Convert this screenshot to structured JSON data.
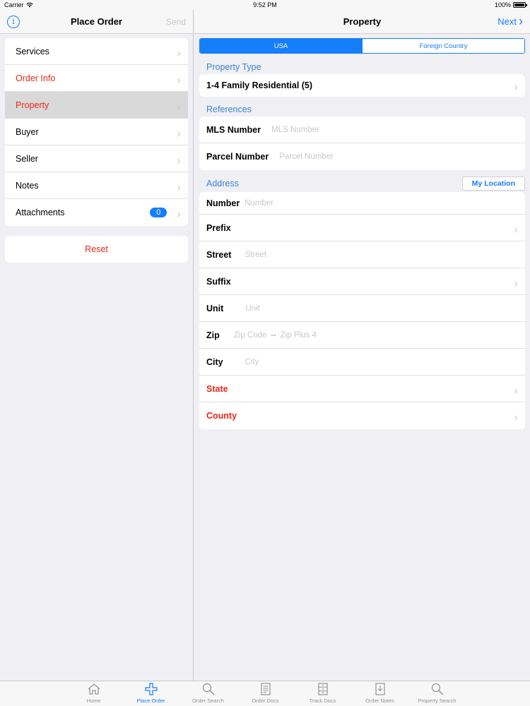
{
  "status": {
    "carrier": "Carrier",
    "time": "9:52 PM",
    "battery": "100%"
  },
  "left": {
    "title": "Place Order",
    "send": "Send",
    "menu": [
      {
        "label": "Services"
      },
      {
        "label": "Order Info"
      },
      {
        "label": "Property"
      },
      {
        "label": "Buyer"
      },
      {
        "label": "Seller"
      },
      {
        "label": "Notes"
      },
      {
        "label": "Attachments",
        "badge": "0"
      }
    ],
    "reset": "Reset"
  },
  "right": {
    "title": "Property",
    "next": "Next",
    "segments": [
      "USA",
      "Foreign Country"
    ],
    "property_type_header": "Property Type",
    "property_type_value": "1-4 Family Residential (5)",
    "references_header": "References",
    "mls_label": "MLS Number",
    "mls_placeholder": "MLS Number",
    "parcel_label": "Parcel Number",
    "parcel_placeholder": "Parcel Number",
    "address_header": "Address",
    "my_location": "My Location",
    "number_label": "Number",
    "number_placeholder": "Number",
    "prefix_label": "Prefix",
    "street_label": "Street",
    "street_placeholder": "Street",
    "suffix_label": "Suffix",
    "unit_label": "Unit",
    "unit_placeholder": "Unit",
    "zip_label": "Zip",
    "zip_placeholder": "Zip Code",
    "zip_dash": "--",
    "zip4_placeholder": "Zip Plus 4",
    "city_label": "City",
    "city_placeholder": "City",
    "state_label": "State",
    "county_label": "County"
  },
  "tabs": [
    {
      "label": "Home",
      "icon": "home-icon"
    },
    {
      "label": "Place Order",
      "icon": "plus-icon"
    },
    {
      "label": "Order Search",
      "icon": "search-icon"
    },
    {
      "label": "Order Docs",
      "icon": "document-icon"
    },
    {
      "label": "Track Docs",
      "icon": "cabinet-icon"
    },
    {
      "label": "Order Notes",
      "icon": "notes-icon"
    },
    {
      "label": "Property Search",
      "icon": "search-icon"
    }
  ],
  "colors": {
    "accent": "#157efb",
    "danger": "#e8271a",
    "section": "#3b86d6"
  }
}
